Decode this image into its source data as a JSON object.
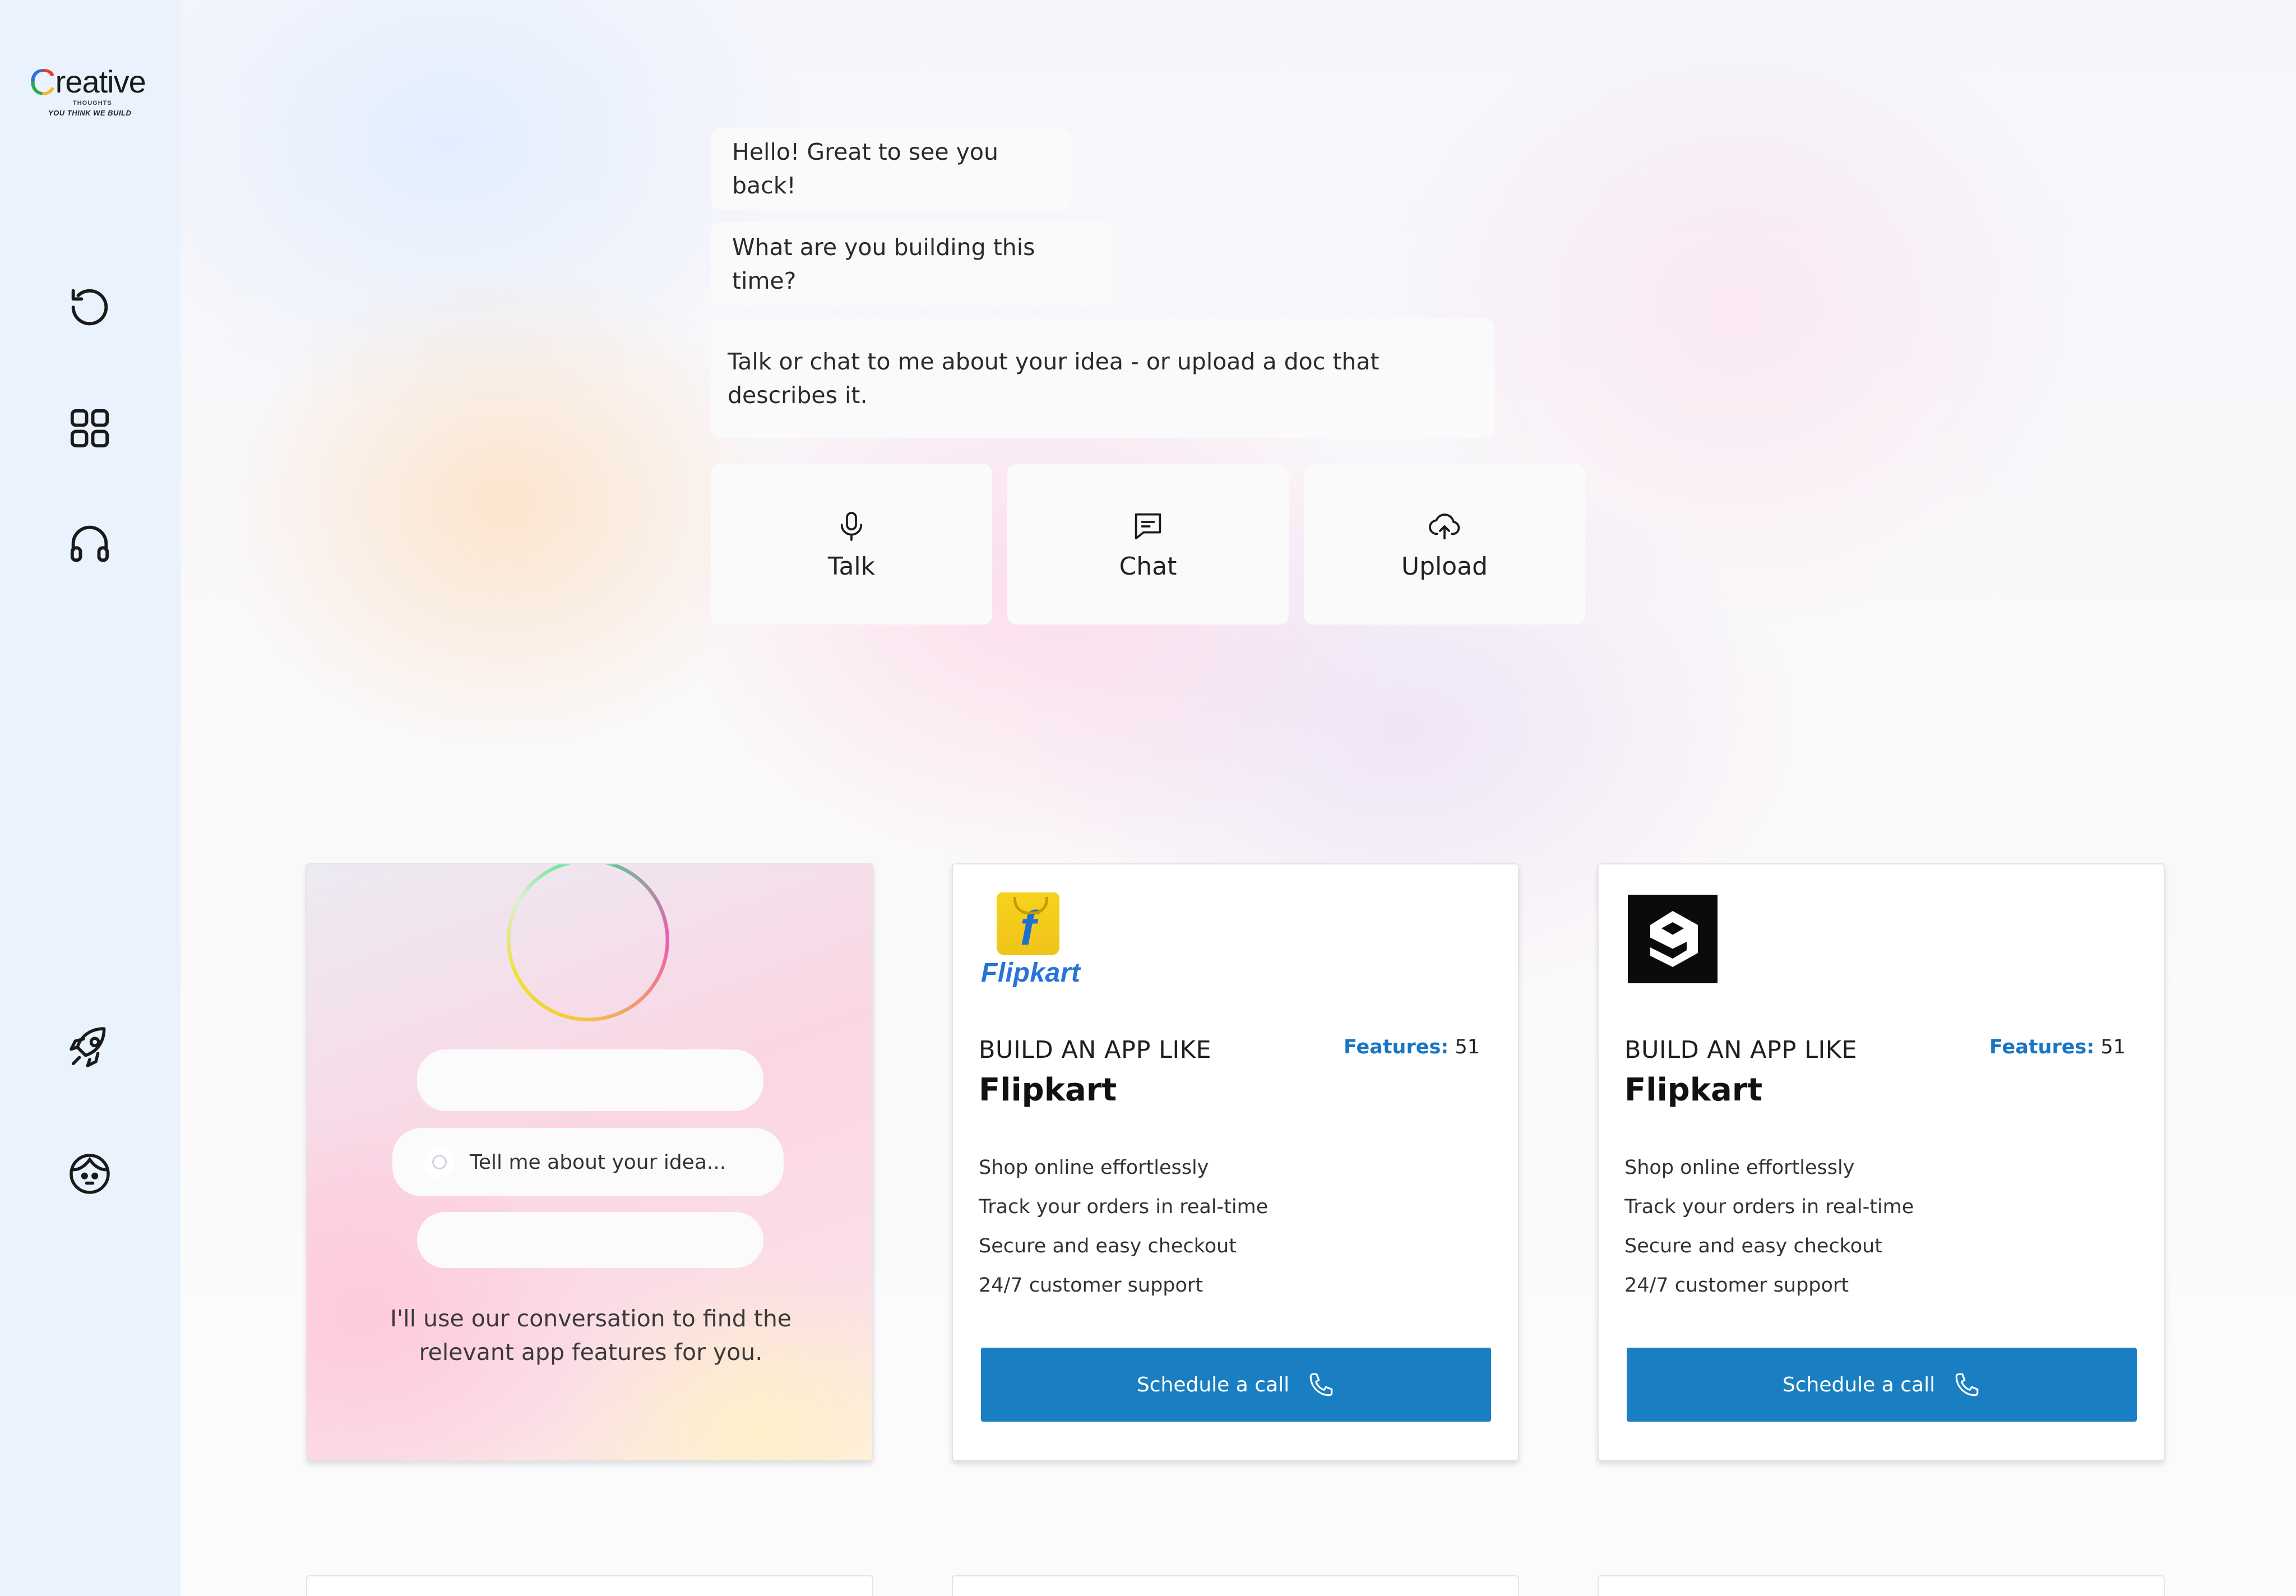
{
  "brand": {
    "logo_letter": "C",
    "logo_text": "reative",
    "logo_sub": "THOUGHTS",
    "tagline": "YOU THINK WE BUILD"
  },
  "sidebar": {
    "items": [
      {
        "icon": "history-icon"
      },
      {
        "icon": "grid-icon"
      },
      {
        "icon": "headphones-icon"
      },
      {
        "icon": "rocket-icon"
      },
      {
        "icon": "avatar-icon"
      }
    ]
  },
  "chat": {
    "messages": [
      "Hello! Great to see you back!",
      "What are you building this time?",
      "Talk or chat to me about your idea - or upload a doc that describes it."
    ],
    "actions": [
      {
        "label": "Talk",
        "icon": "microphone-icon"
      },
      {
        "label": "Chat",
        "icon": "chat-icon"
      },
      {
        "label": "Upload",
        "icon": "cloud-upload-icon"
      }
    ]
  },
  "assistant_card": {
    "input_placeholder": "Tell me about your idea...",
    "caption": "I'll use our conversation to find the relevant app features for you."
  },
  "app_cards": [
    {
      "logo": "flipkart-logo",
      "logo_text": "Flipkart",
      "build_prefix": "BUILD AN APP LIKE",
      "name": "Flipkart",
      "features_label": "Features:",
      "features_count": "51",
      "features": [
        "Shop online effortlessly",
        "Track your orders in real-time",
        "Secure and easy checkout",
        "24/7 customer support"
      ],
      "cta": "Schedule a call"
    },
    {
      "logo": "9gag-logo",
      "build_prefix": "BUILD AN APP LIKE",
      "name": "Flipkart",
      "features_label": "Features:",
      "features_count": "51",
      "features": [
        "Shop online effortlessly",
        "Track your orders in real-time",
        "Secure and easy checkout",
        "24/7 customer support"
      ],
      "cta": "Schedule a call"
    }
  ],
  "colors": {
    "accent": "#1a7fc2",
    "sidebar_bg": "#eaf3fd",
    "features_key": "#1a76c2"
  }
}
